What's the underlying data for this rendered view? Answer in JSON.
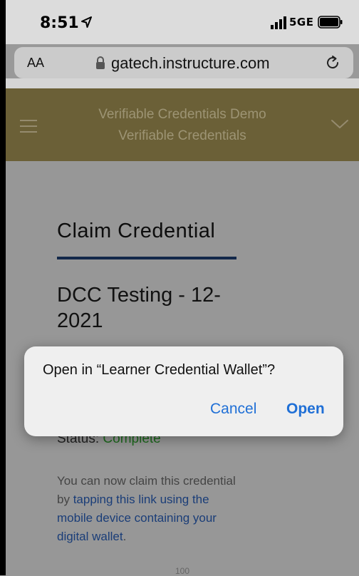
{
  "status_bar": {
    "time": "8:51",
    "network": "5GE"
  },
  "address_bar": {
    "text_size_label": "AA",
    "url": "gatech.instructure.com"
  },
  "header": {
    "line1": "Verifiable Credentials Demo",
    "line2": "Verifiable Credentials"
  },
  "content": {
    "title": "Claim Credential",
    "course_name": "DCC Testing - 12-2021",
    "status_label": "Status: ",
    "status_value": "Complete",
    "para_prefix": "You can now claim this credential by ",
    "para_link": "tapping this link using the mobile device containing your digital wallet",
    "para_suffix": ".",
    "footer_number": "100"
  },
  "dialog": {
    "message": "Open in “Learner Credential Wallet”?",
    "cancel_label": "Cancel",
    "open_label": "Open"
  },
  "colors": {
    "header_bg": "#6b6037",
    "link": "#1f6fd6",
    "rule": "#13284a",
    "status_ok": "#1e6b1e"
  }
}
